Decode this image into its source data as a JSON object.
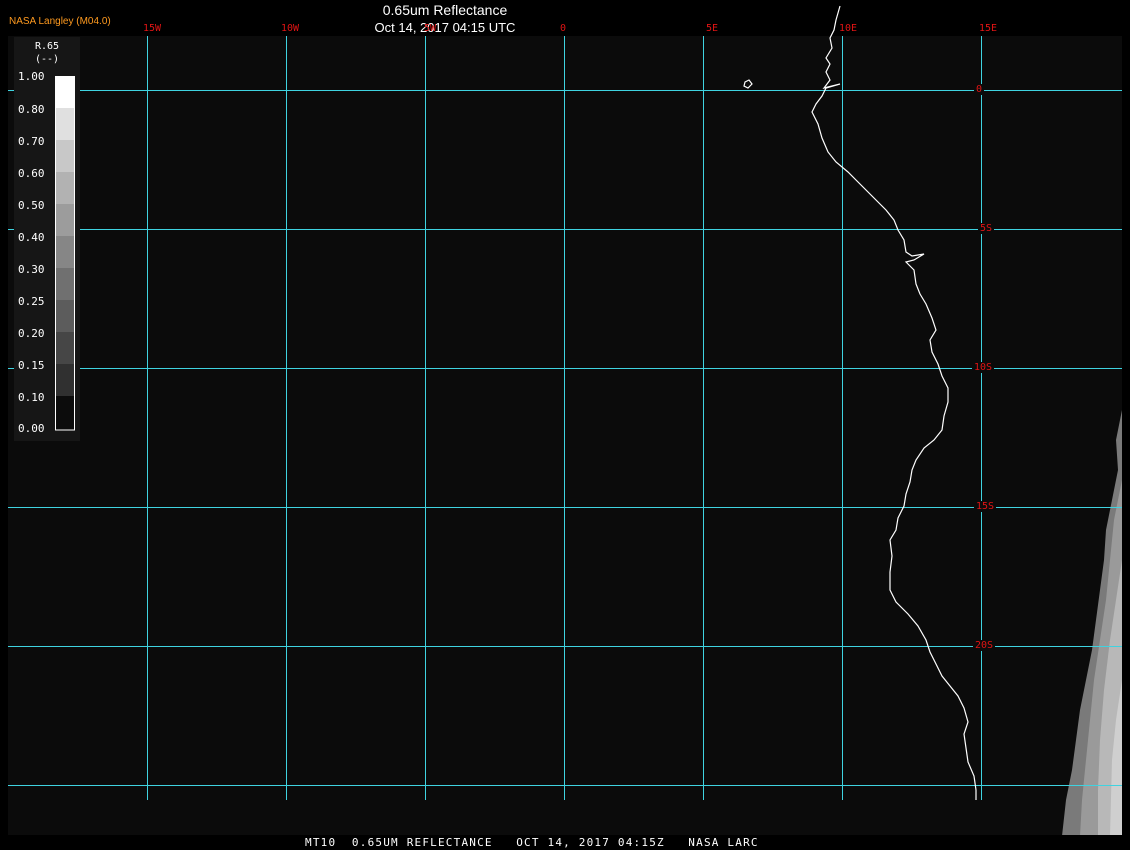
{
  "credit": "NASA Langley (M04.0)",
  "title": "0.65um Reflectance",
  "subtitle": "Oct 14, 2017 04:15 UTC",
  "footer": "MT10  0.65UM REFLECTANCE   OCT 14, 2017 04:15Z   NASA LARC",
  "colors": {
    "grid": "#3fd3e0",
    "coast": "#ffffff",
    "label": "#e01414",
    "credit": "#ff9a1f",
    "background": "#0b0b0b"
  },
  "lon_labels": [
    "15W",
    "10W",
    "5W",
    "0",
    "5E",
    "10E",
    "15E"
  ],
  "lat_labels": [
    "0",
    "5S",
    "10S",
    "15S",
    "20S"
  ],
  "legend": {
    "title": "R.65",
    "units": "(--)",
    "ticks": [
      "1.00",
      "0.80",
      "0.70",
      "0.60",
      "0.50",
      "0.40",
      "0.30",
      "0.25",
      "0.20",
      "0.15",
      "0.10",
      "0.00"
    ]
  }
}
